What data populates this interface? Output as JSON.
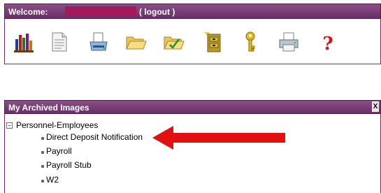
{
  "header": {
    "welcome_label": "Welcome:",
    "logout_label": "( logout )"
  },
  "toolbar": {
    "icons": [
      "library-icon",
      "document-icon",
      "scanner-icon",
      "open-folder-icon",
      "checked-folder-icon",
      "archive-cabinet-icon",
      "key-icon",
      "printer-icon",
      "help-icon"
    ]
  },
  "panel": {
    "title": "My Archived Images",
    "close_label": "X"
  },
  "tree": {
    "root": {
      "toggle": "−",
      "label": "Personnel-Employees"
    },
    "items": [
      {
        "label": "Direct Deposit Notification"
      },
      {
        "label": "Payroll"
      },
      {
        "label": "Payroll Stub"
      },
      {
        "label": "W2"
      }
    ]
  },
  "colors": {
    "header_purple": "#6a2f68",
    "redaction": "#a21a5c",
    "arrow": "#e21010"
  }
}
